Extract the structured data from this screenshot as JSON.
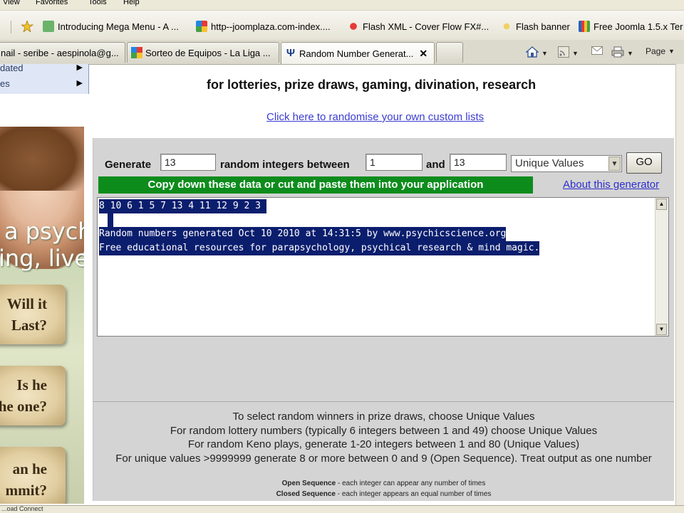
{
  "menu": [
    "View",
    "Favorites",
    "Tools",
    "Help"
  ],
  "favorites": [
    {
      "label": "Introducing Mega Menu - A ...",
      "icon": "page-icon"
    },
    {
      "label": "http--joomplaza.com-index....",
      "icon": "joomla-icon"
    },
    {
      "label": "Flash XML - Cover Flow FX#...",
      "icon": "flash-icon"
    },
    {
      "label": "Flash banner",
      "icon": "flash-icon"
    },
    {
      "label": "Free Joomla 1.5.x Ter",
      "icon": "books-icon"
    }
  ],
  "tabs": [
    {
      "label": "nail - seribe - aespinola@g...",
      "active": false
    },
    {
      "label": "Sorteo de Equipos - La Liga ...",
      "active": false
    },
    {
      "label": "Random Number Generat...",
      "active": true
    }
  ],
  "toolbar": {
    "page_label": "Page"
  },
  "sidebar": {
    "menu_items": [
      "dated",
      "es"
    ],
    "ad_text": {
      "line1": "a psychic",
      "line2": "ing, live!"
    },
    "scrolls": [
      {
        "line1": "Will it",
        "line2": "Last?"
      },
      {
        "line1": "Is he",
        "line2": "he one?"
      },
      {
        "line1": "an he",
        "line2": "mmit?"
      }
    ]
  },
  "main": {
    "tagline": "for lotteries, prize draws, gaming, divination, research",
    "custom_link": "Click here to randomise your own custom lists",
    "generate_label": "Generate",
    "count": "13",
    "between_label": "random integers between",
    "min": "1",
    "and_label": "and",
    "max": "13",
    "mode": "Unique Values",
    "go_label": "GO",
    "copy_banner": "Copy down these data or cut and paste them into your application",
    "about_link": "About this generator",
    "output_lines": [
      "8 10 6 1 5 7 13 4 11 12 9 2 3 ",
      " ",
      "Random numbers generated Oct 10 2010 at 14:31:5 by www.psychicscience.org",
      "Free educational resources for parapsychology, psychical research & mind magic."
    ],
    "info_lines": [
      "To select random winners in prize draws, choose Unique Values",
      "For random lottery numbers (typically 6 integers between 1 and 49) choose Unique Values",
      "For random Keno plays, generate 1-20 integers between 1 and 80 (Unique Values)",
      "For unique values >9999999 generate 8 or more between 0 and 9 (Open Sequence). Treat output as one number"
    ],
    "open_seq_label": "Open Sequence",
    "open_seq_desc": " - each integer can appear any number of times",
    "closed_seq_label": "Closed Sequence",
    "closed_seq_desc": " - each integer appears an equal number of times"
  },
  "status": {
    "text": "...oad Connect"
  },
  "colors": {
    "output_highlight": "#0b1e6e",
    "banner": "#0d8c1c",
    "link": "#3b3bd1",
    "panel": "#d4d4d4"
  }
}
